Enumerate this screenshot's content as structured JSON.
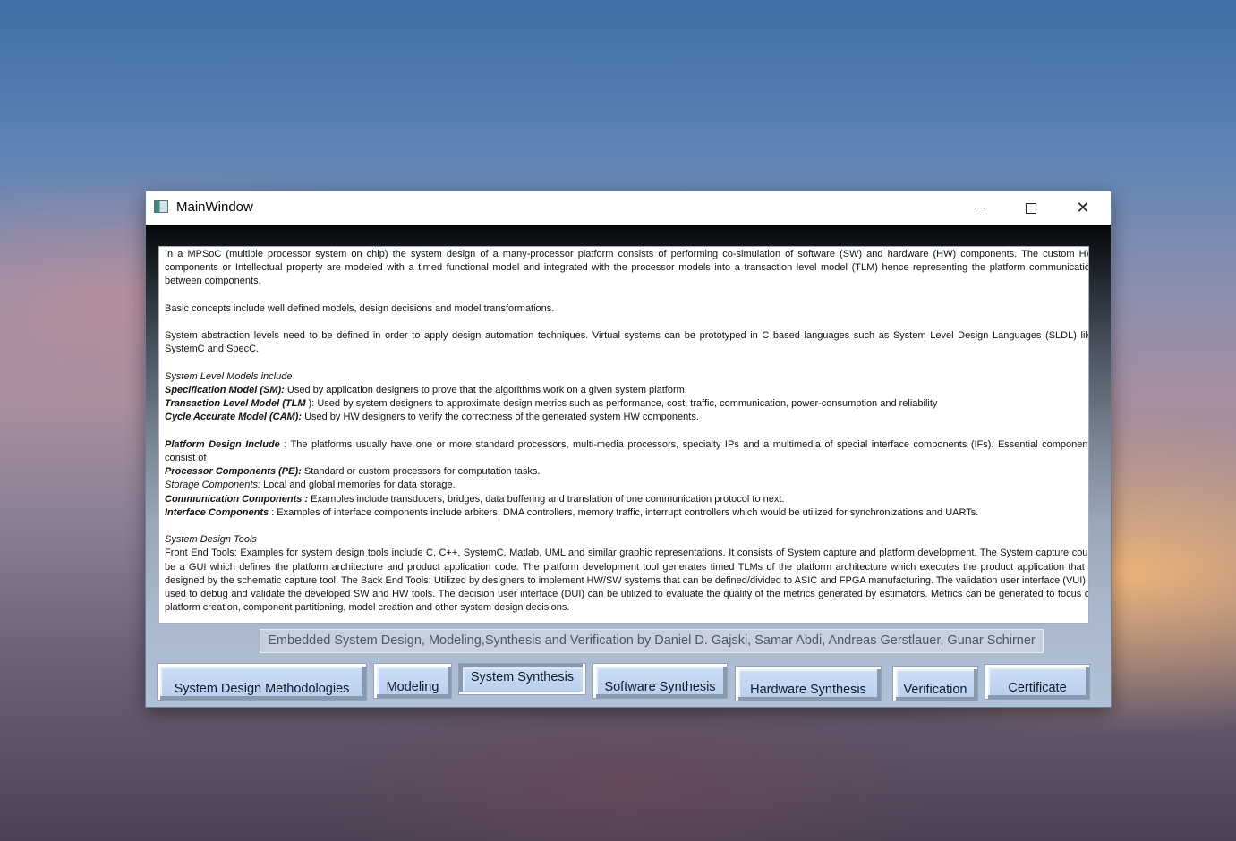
{
  "window": {
    "title": "MainWindow",
    "controls": {
      "minimize": "—",
      "maximize": "☐",
      "close": "✕"
    }
  },
  "content": {
    "p1": "In a MPSoC (multiple processor system on chip) the system design of a many-processor platform consists of  performing co-simulation of software (SW) and hardware (HW) components.  The custom HW components or Intellectual property are modeled with a timed functional model and integrated with the processor models into a transaction level model (TLM) hence representing the platform communication between components.",
    "p2": "Basic concepts include well defined models, design decisions and model transformations.",
    "p3": "System abstraction levels need to be defined in order to apply design automation techniques. Virtual systems can be prototyped in C based languages such as System Level Design Languages (SLDL) like SystemC and SpecC.",
    "models_heading": "System Level Models include",
    "models": [
      {
        "term": "Specification Model (SM):",
        "desc": "  Used by application designers to prove that the algorithms work on a given system platform."
      },
      {
        "term": "Transaction Level Model (TLM",
        "desc": " ): Used by system designers to approximate design metrics such as performance, cost, traffic, communication, power-consumption and reliability"
      },
      {
        "term": "Cycle Accurate Model (CAM):",
        "desc": "  Used by HW designers to verify the correctness of the generated system HW components."
      }
    ],
    "platform_term": "Platform Design Include",
    "platform_desc": " : The platforms usually have one or more standard processors, multi-media processors, specialty IPs and a multimedia of special interface components (IFs).   Essential components consist of",
    "components": [
      {
        "term": "Processor Components (PE):",
        "desc": "    Standard or custom processors for computation tasks.",
        "style": "bi"
      },
      {
        "term": "Storage Components:",
        "desc": "  Local and global memories for data storage.",
        "style": "it"
      },
      {
        "term": "Communication Components :",
        "desc": "  Examples include transducers, bridges, data buffering and translation of one communication protocol to next.",
        "style": "bi"
      },
      {
        "term": "Interface Components",
        "desc": " :  Examples of interface components include arbiters, DMA controllers, memory traffic, interrupt controllers which would be utilized for synchronizations and UARTs.",
        "style": "bi"
      }
    ],
    "tools_heading": "System Design Tools",
    "tools_text": "Front End Tools: Examples for system design tools include C, C++, SystemC, Matlab, UML and similar graphic representations. It consists of System capture and platform development.  The System capture could be a GUI which defines the platform architecture and product application code. The platform development tool generates timed TLMs of the platform architecture which executes the product application that is designed by the schematic capture tool.  The Back End Tools:  Utilized by designers to implement HW/SW systems that can be defined/divided to ASIC and FPGA manufacturing.   The validation user interface (VUI) is used to debug and validate the developed SW and HW tools.  The decision user interface (DUI) can be utilized to evaluate the quality of the metrics generated by estimators.  Metrics can be generated to focus on platform creation, component partitioning, model creation and other system design decisions."
  },
  "caption": "Embedded System Design, Modeling,Synthesis and Verification by Daniel D. Gajski, Samar Abdi, Andreas Gerstlauer, Gunar Schirner",
  "buttons": {
    "methodologies": "System Design Methodologies",
    "modeling": "Modeling",
    "system_synthesis": "System Synthesis",
    "software_synthesis": "Software Synthesis",
    "hardware_synthesis": "Hardware Synthesis",
    "verification": "Verification",
    "certificate": "Certificate"
  }
}
